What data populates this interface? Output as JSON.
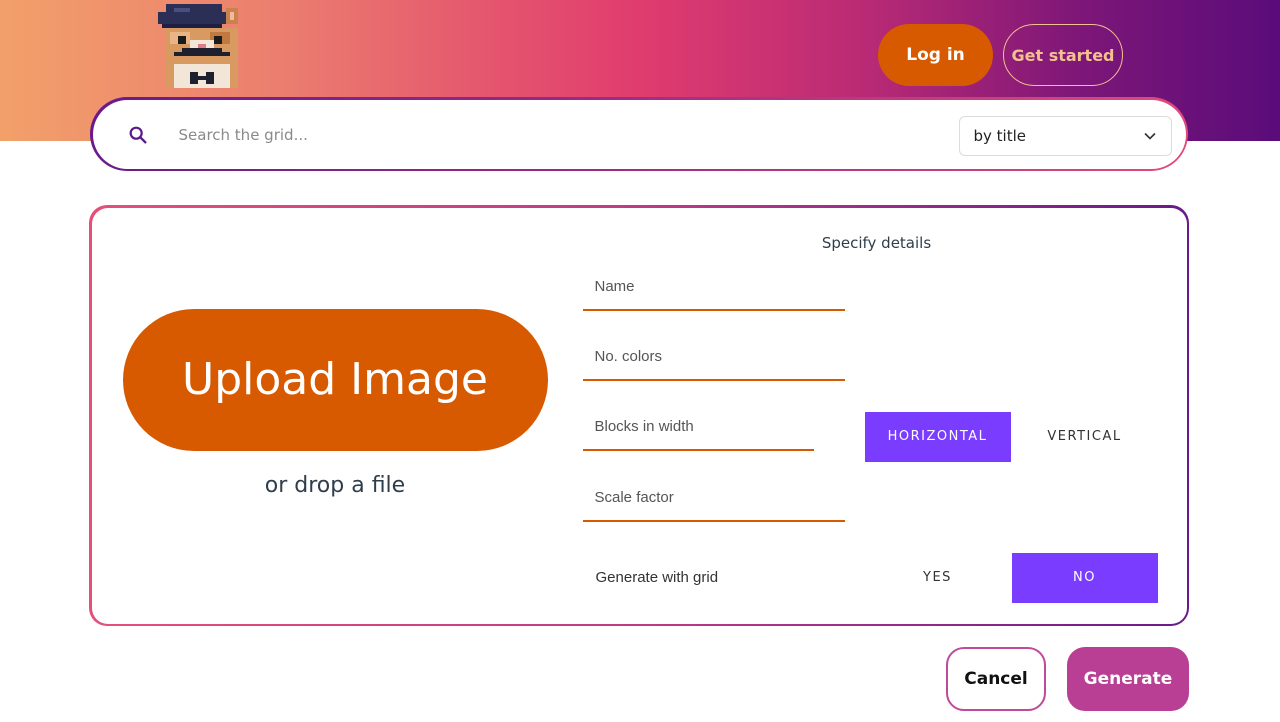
{
  "header": {
    "login_label": "Log in",
    "get_started_label": "Get started"
  },
  "search": {
    "placeholder": "Search the grid...",
    "value": "",
    "filter_selected": "by title"
  },
  "upload": {
    "button_label": "Upload Image",
    "drop_text": "or drop a file"
  },
  "details": {
    "title": "Specify details",
    "name_placeholder": "Name",
    "colors_placeholder": "No. colors",
    "blocks_placeholder": "Blocks in width",
    "scale_placeholder": "Scale factor",
    "orientation": {
      "horizontal_label": "HORIZONTAL",
      "vertical_label": "VERTICAL",
      "selected": "HORIZONTAL"
    },
    "grid": {
      "label": "Generate with grid",
      "yes_label": "YES",
      "no_label": "NO",
      "selected": "NO"
    }
  },
  "actions": {
    "cancel_label": "Cancel",
    "generate_label": "Generate"
  },
  "colors": {
    "accent_orange": "#d85a00",
    "toggle_active": "#7a3cff",
    "generate_magenta": "#b83f93"
  },
  "icons": {
    "logo": "pixel-cat-beret-mustache-logo",
    "search": "search-icon",
    "dropdown": "chevron-down-icon"
  }
}
